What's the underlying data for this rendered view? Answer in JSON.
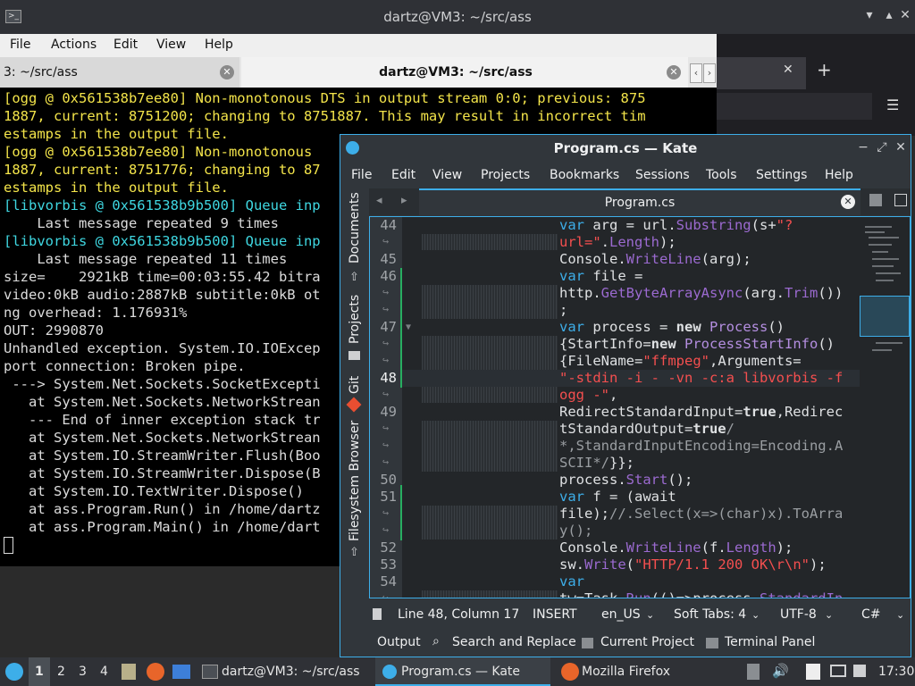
{
  "terminal": {
    "title": "dartz@VM3: ~/src/ass",
    "menu": [
      "File",
      "Actions",
      "Edit",
      "View",
      "Help"
    ],
    "tabs": [
      {
        "label": "3: ~/src/ass"
      },
      {
        "label": "dartz@VM3: ~/src/ass"
      }
    ],
    "lines": [
      {
        "text": "[ogg @ 0x561538b7ee80] Non-monotonous DTS in output stream 0:0; previous: 875",
        "color": "yellow"
      },
      {
        "text": "1887, current: 8751200; changing to 8751887. This may result in incorrect tim",
        "color": "yellow"
      },
      {
        "text": "estamps in the output file.",
        "color": "yellow"
      },
      {
        "text": "[ogg @ 0x561538b7ee80] Non-monotonous",
        "color": "yellow"
      },
      {
        "text": "1887, current: 8751776; changing to 87",
        "color": "yellow"
      },
      {
        "text": "estamps in the output file.",
        "color": "yellow"
      },
      {
        "text": "[libvorbis @ 0x561538b9b500] Queue inp",
        "color": "cyan"
      },
      {
        "text": "    Last message repeated 9 times",
        "color": "white"
      },
      {
        "text": "[libvorbis @ 0x561538b9b500] Queue inp",
        "color": "cyan"
      },
      {
        "text": "    Last message repeated 11 times",
        "color": "white"
      },
      {
        "text": "size=    2921kB time=00:03:55.42 bitra",
        "color": "white"
      },
      {
        "text": "video:0kB audio:2887kB subtitle:0kB ot",
        "color": "white"
      },
      {
        "text": "ng overhead: 1.176931%",
        "color": "white"
      },
      {
        "text": "OUT: 2990870",
        "color": "white"
      },
      {
        "text": "Unhandled exception. System.IO.IOExcep",
        "color": "white"
      },
      {
        "text": "port connection: Broken pipe.",
        "color": "white"
      },
      {
        "text": " ---> System.Net.Sockets.SocketExcepti",
        "color": "white"
      },
      {
        "text": "   at System.Net.Sockets.NetworkStrean",
        "color": "white"
      },
      {
        "text": "   --- End of inner exception stack tr",
        "color": "white"
      },
      {
        "text": "   at System.Net.Sockets.NetworkStrean",
        "color": "white"
      },
      {
        "text": "   at System.IO.StreamWriter.Flush(Boo",
        "color": "white"
      },
      {
        "text": "   at System.IO.StreamWriter.Dispose(B",
        "color": "white"
      },
      {
        "text": "   at System.IO.TextWriter.Dispose()",
        "color": "white"
      },
      {
        "text": "   at ass.Program.Run() in /home/dartz",
        "color": "white"
      },
      {
        "text": "   at ass.Program.Main() in /home/dart",
        "color": "white"
      }
    ]
  },
  "kate": {
    "title": "Program.cs  — Kate",
    "menu": [
      "File",
      "Edit",
      "View",
      "Projects",
      "Bookmarks",
      "Sessions",
      "Tools",
      "Settings",
      "Help"
    ],
    "sidebar": [
      "Documents",
      "Projects",
      "Git",
      "Filesystem Browser"
    ],
    "tab_label": "Program.cs",
    "line_numbers": [
      "44",
      "45",
      "46",
      "47",
      "48",
      "49",
      "50",
      "51",
      "52",
      "53",
      "54"
    ],
    "status": {
      "position": "Line 48, Column 17",
      "mode": "INSERT",
      "language": "en_US",
      "indent": "Soft Tabs: 4",
      "encoding": "UTF-8",
      "syntax": "C#"
    },
    "toolviews": [
      "Output",
      "Search and Replace",
      "Current Project",
      "Terminal Panel"
    ]
  },
  "taskbar": {
    "desktops": [
      "1",
      "2",
      "3",
      "4"
    ],
    "tasks": [
      "dartz@VM3: ~/src/ass",
      "Program.cs — Kate",
      "Mozilla Firefox"
    ],
    "clock": "17:30"
  },
  "colors": {
    "accent": "#3daee9",
    "terminal_yellow": "#f3e44a",
    "terminal_cyan": "#3fd7e1",
    "string_red": "#f44f4f"
  }
}
